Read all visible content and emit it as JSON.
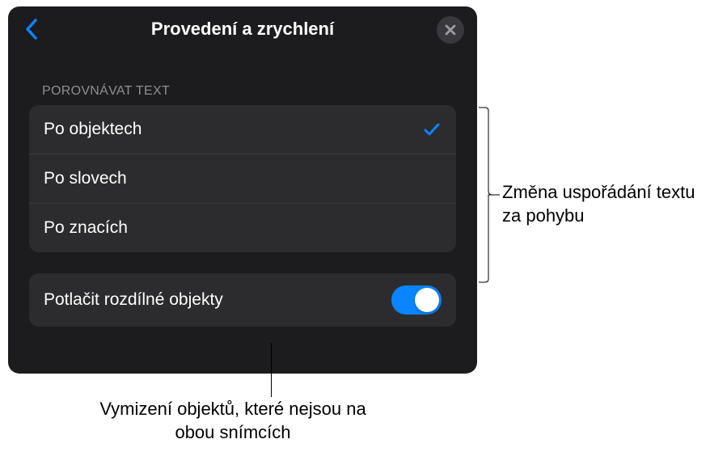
{
  "panel": {
    "title": "Provedení a zrychlení"
  },
  "section": {
    "header": "Porovnávat text",
    "options": [
      {
        "label": "Po objektech",
        "selected": true
      },
      {
        "label": "Po slovech",
        "selected": false
      },
      {
        "label": "Po znacích",
        "selected": false
      }
    ]
  },
  "toggleRow": {
    "label": "Potlačit rozdílné objekty",
    "on": true
  },
  "callouts": {
    "right": "Změna uspořádání textu za pohybu",
    "bottom": "Vymizení objektů, které nejsou na obou snímcích"
  }
}
